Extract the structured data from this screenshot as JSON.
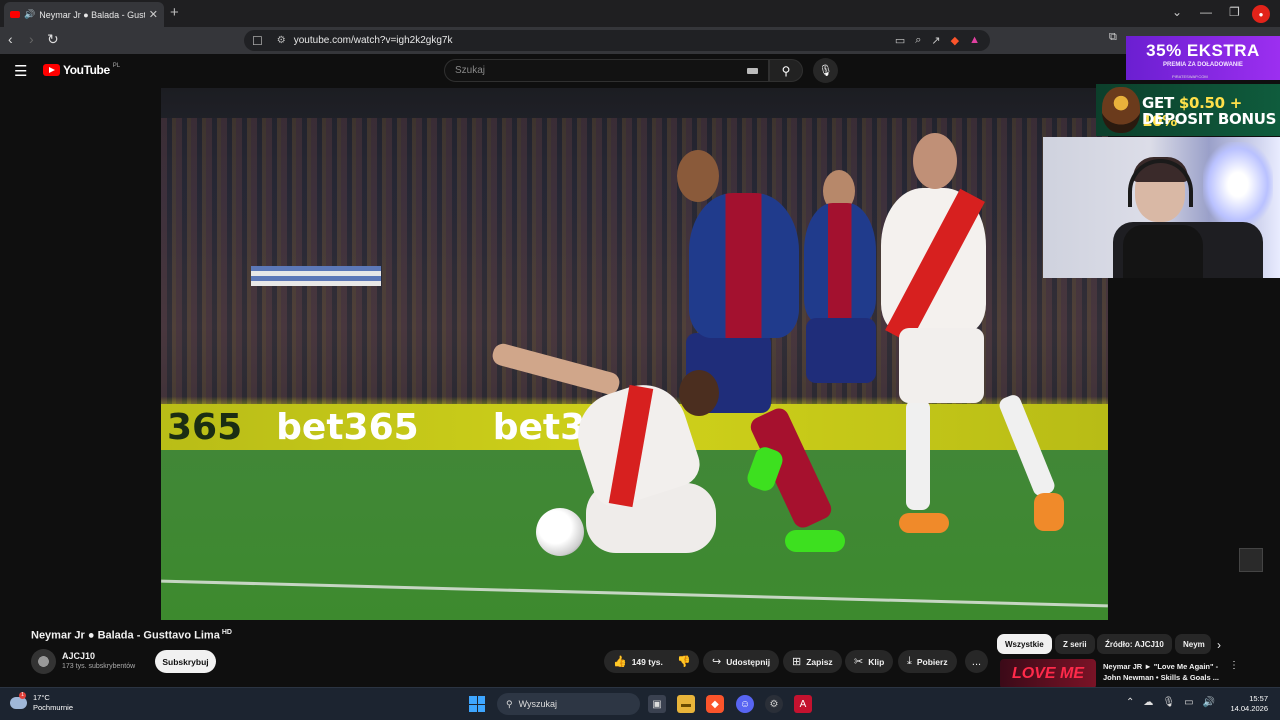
{
  "browser": {
    "tab_title": "Neymar Jr ● Balada - Gusttavo Lima",
    "new_tab": "+",
    "url": "youtube.com/watch?v=igh2k2gkg7k"
  },
  "youtube": {
    "logo_text": "YouTube",
    "country_code": "PL",
    "search_placeholder": "Szukaj"
  },
  "video": {
    "title": "Neymar Jr ● Balada - Gusttavo Lima",
    "hd_badge": "HD",
    "adboard_text": [
      "365",
      "bet365",
      "bet365",
      "365",
      "bet36"
    ]
  },
  "channel": {
    "name": "AJCJ10",
    "subscribers": "173 tys. subskrybentów",
    "subscribe_label": "Subskrybuj"
  },
  "actions": {
    "likes": "149 tys.",
    "share": "Udostępnij",
    "save": "Zapisz",
    "clip": "Klip",
    "download": "Pobierz",
    "more": "..."
  },
  "chips": [
    "Wszystkie",
    "Z serii",
    "Źródło: AJCJ10",
    "Neym"
  ],
  "suggestion": {
    "thumb_text": "LOVE ME",
    "title": "Neymar JR ► \"Love Me Again\" - John Newman • Skills & Goals ..."
  },
  "ads": {
    "ad1_big": "35% EKSTRA",
    "ad1_sub": "PREMIA ZA DOŁADOWANIE",
    "ad1_site": "PIRATESWAP.COM",
    "ad2_line1_prefix": "GET ",
    "ad2_line1_highlight": "$0.50 + 10%",
    "ad2_line2": "DEPOSIT BONUS"
  },
  "taskbar": {
    "temperature": "17°C",
    "weather": "Pochmurnie",
    "search_label": "Wyszukaj",
    "time": "15:57",
    "date": "14.04.2026",
    "weather_badge": "1"
  },
  "colors": {
    "youtube_red": "#ff0000",
    "page_bg": "#0f0f0f",
    "taskbar_bg": "#1c2430",
    "ad1_purple": "#9c2ff0"
  }
}
